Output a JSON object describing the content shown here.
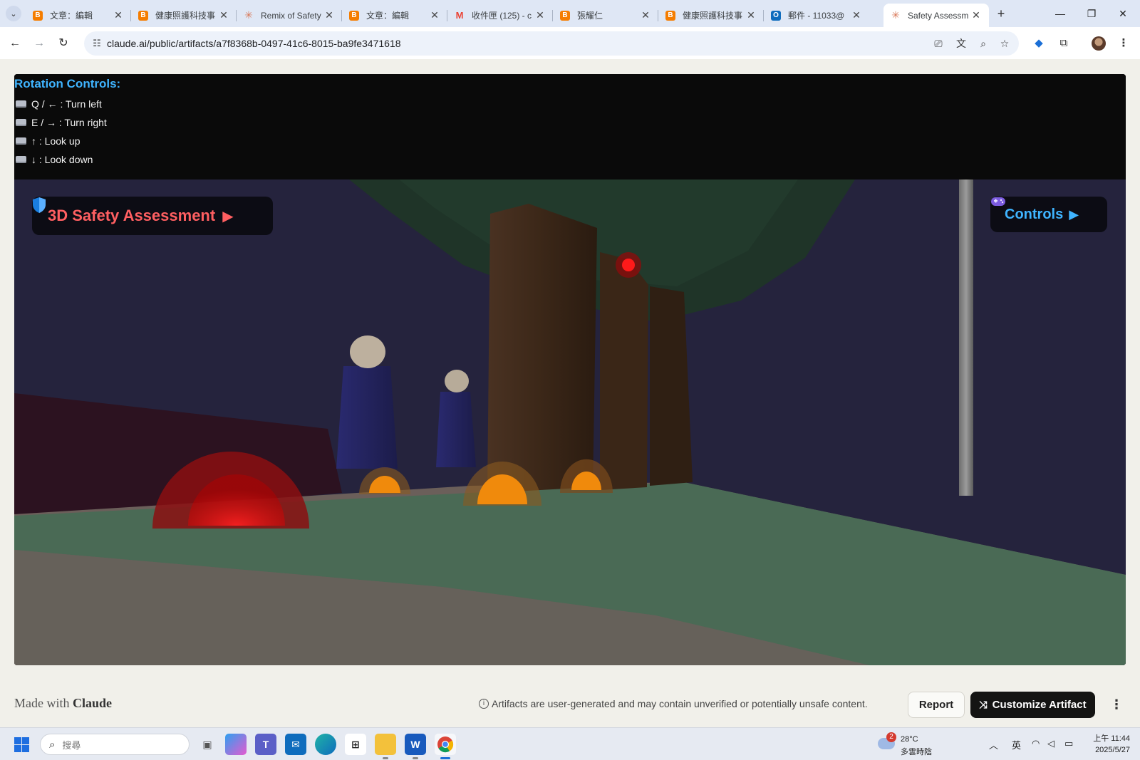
{
  "browser": {
    "tabs": [
      {
        "title": "文章：編輯",
        "icon": "blogger-icon",
        "color": "#f57d00"
      },
      {
        "title": "健康照護科技事",
        "icon": "blogger-icon",
        "color": "#f57d00"
      },
      {
        "title": "Remix of Safety",
        "icon": "claude-icon",
        "color": "#d97757"
      },
      {
        "title": "文章：編輯",
        "icon": "blogger-icon",
        "color": "#f57d00"
      },
      {
        "title": "收件匣 (125) - c",
        "icon": "gmail-icon",
        "color": "#ea4335"
      },
      {
        "title": "張耀仁",
        "icon": "blogger-icon",
        "color": "#f57d00"
      },
      {
        "title": "健康照護科技事",
        "icon": "blogger-icon",
        "color": "#f57d00"
      },
      {
        "title": "郵件 - 11033@",
        "icon": "outlook-icon",
        "color": "#0f6cbd"
      },
      {
        "title": "Safety Assessm",
        "icon": "claude-icon",
        "color": "#d97757"
      }
    ],
    "active_tab": 8,
    "url": "claude.ai/public/artifacts/a7f8368b-0497-41c6-8015-ba9fe3471618"
  },
  "artifact": {
    "rotation_title": "Rotation Controls:",
    "rotation_lines": [
      {
        "text": "Q / ← : Turn left"
      },
      {
        "text": "E / → : Turn right"
      },
      {
        "text": "↑ : Look up"
      },
      {
        "text": "↓ : Look down"
      }
    ],
    "hud_title": "3D Safety Assessment",
    "hud_controls": "Controls",
    "accent_red": "#ff5f61",
    "accent_blue": "#3fb4ff"
  },
  "footer": {
    "made_prefix": "Made with",
    "made_brand": "Claude",
    "disclaimer": "Artifacts are user-generated and may contain unverified or potentially unsafe content.",
    "report_label": "Report",
    "customize_label": "Customize Artifact"
  },
  "taskbar": {
    "search_placeholder": "搜尋",
    "weather_badge": "2",
    "weather_temp": "28°C",
    "weather_desc": "多雲時陰",
    "ime": "英",
    "time": "上午 11:44",
    "date": "2025/5/27"
  }
}
